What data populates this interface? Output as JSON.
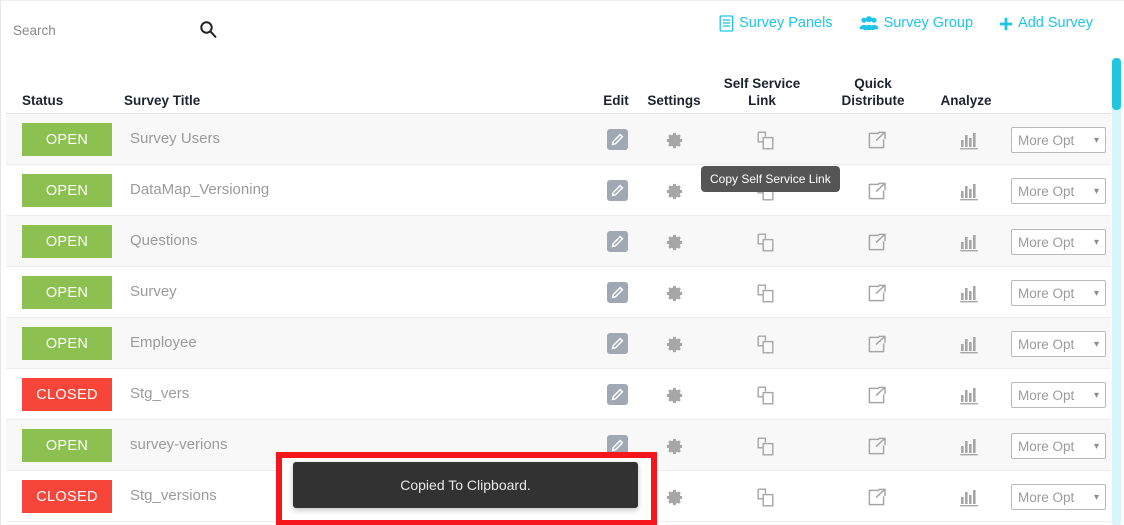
{
  "search": {
    "placeholder": "Search",
    "value": "",
    "icon": "search-icon"
  },
  "toplinks": [
    {
      "label": "Survey Panels",
      "icon": "document-icon"
    },
    {
      "label": "Survey Group",
      "icon": "users-group-icon"
    },
    {
      "label": "Add Survey",
      "icon": "plus-icon"
    }
  ],
  "accent_color": "#1ec6e6",
  "table": {
    "headers": {
      "status": "Status",
      "title": "Survey Title",
      "edit": "Edit",
      "settings": "Settings",
      "self_service_link_1": "Self Service",
      "self_service_link_2": "Link",
      "quick_distribute_1": "Quick",
      "quick_distribute_2": "Distribute",
      "analyze": "Analyze"
    },
    "more_options_label": "More Opt",
    "status_colors": {
      "open": "#8cc152",
      "closed": "#f8453a"
    },
    "rows": [
      {
        "status": "OPEN",
        "title": "Survey Users"
      },
      {
        "status": "OPEN",
        "title": "DataMap_Versioning"
      },
      {
        "status": "OPEN",
        "title": "Questions"
      },
      {
        "status": "OPEN",
        "title": "Survey"
      },
      {
        "status": "OPEN",
        "title": "Employee"
      },
      {
        "status": "CLOSED",
        "title": "Stg_vers"
      },
      {
        "status": "OPEN",
        "title": "survey-verions"
      },
      {
        "status": "CLOSED",
        "title": "Stg_versions"
      }
    ]
  },
  "tooltip": {
    "text": "Copy Self Service Link"
  },
  "toast": {
    "text": "Copied To Clipboard."
  },
  "annotation": {
    "color": "#f5161b"
  },
  "scrollbar": {
    "track_color": "#d6f6fc",
    "thumb_color": "#22c6e0"
  }
}
